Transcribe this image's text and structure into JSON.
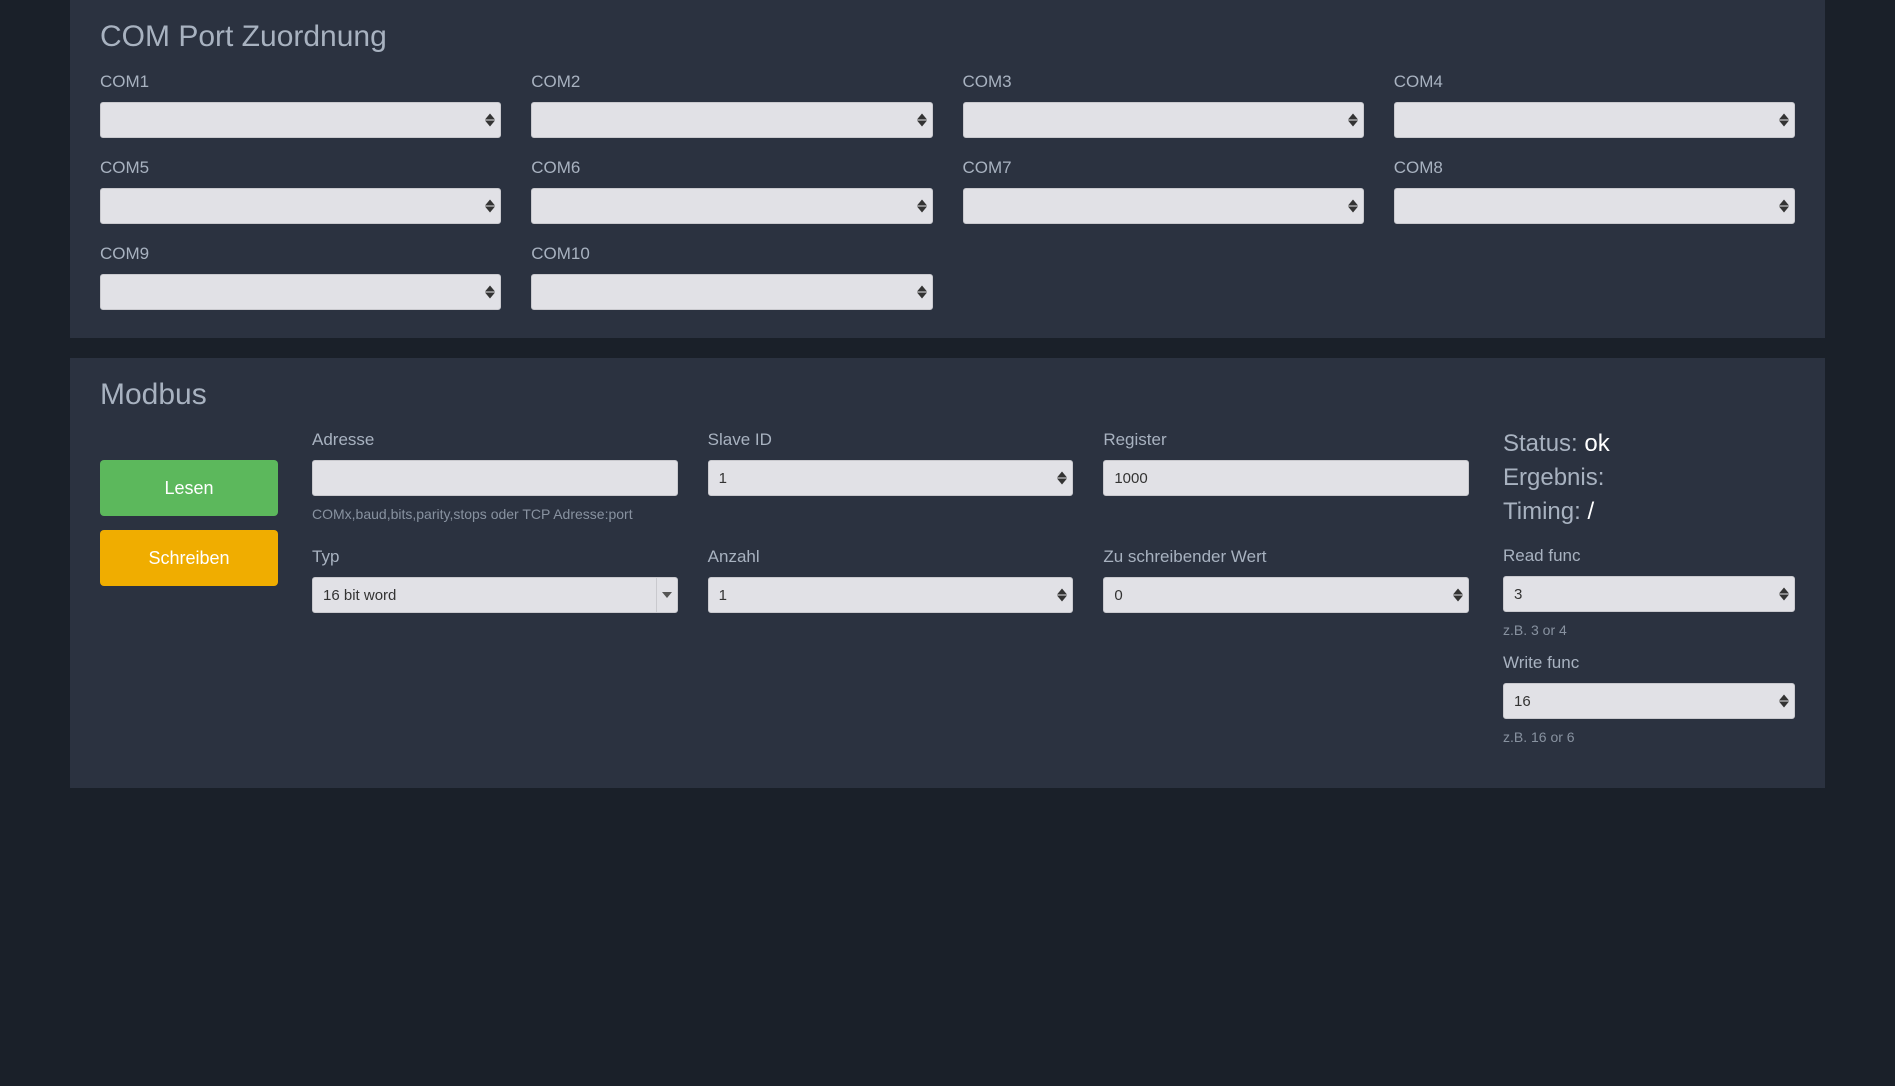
{
  "com_panel": {
    "title": "COM Port Zuordnung",
    "ports": [
      {
        "label": "COM1",
        "value": ""
      },
      {
        "label": "COM2",
        "value": ""
      },
      {
        "label": "COM3",
        "value": ""
      },
      {
        "label": "COM4",
        "value": ""
      },
      {
        "label": "COM5",
        "value": ""
      },
      {
        "label": "COM6",
        "value": ""
      },
      {
        "label": "COM7",
        "value": ""
      },
      {
        "label": "COM8",
        "value": ""
      },
      {
        "label": "COM9",
        "value": ""
      },
      {
        "label": "COM10",
        "value": ""
      }
    ]
  },
  "modbus": {
    "title": "Modbus",
    "buttons": {
      "read": "Lesen",
      "write": "Schreiben"
    },
    "fields": {
      "address": {
        "label": "Adresse",
        "value": "",
        "help": "COMx,baud,bits,parity,stops oder TCP Adresse:port"
      },
      "slave_id": {
        "label": "Slave ID",
        "value": "1"
      },
      "register": {
        "label": "Register",
        "value": "1000"
      },
      "type": {
        "label": "Typ",
        "value": "16 bit word"
      },
      "count": {
        "label": "Anzahl",
        "value": "1"
      },
      "write_value": {
        "label": "Zu schreibender Wert",
        "value": "0"
      }
    },
    "status": {
      "status_label": "Status:",
      "status_value": "ok",
      "result_label": "Ergebnis:",
      "result_value": "",
      "timing_label": "Timing:",
      "timing_value": "/"
    },
    "side": {
      "read_func": {
        "label": "Read func",
        "value": "3",
        "help": "z.B. 3 or 4"
      },
      "write_func": {
        "label": "Write func",
        "value": "16",
        "help": "z.B. 16 or 6"
      }
    }
  }
}
